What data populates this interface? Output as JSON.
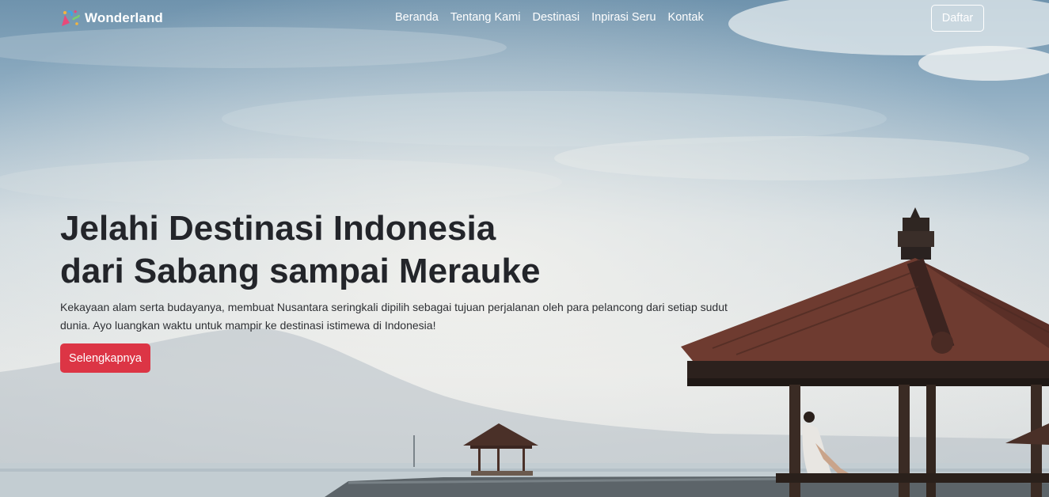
{
  "brand": {
    "name": "Wonderland",
    "logo_icon": "confetti-logo-icon"
  },
  "nav": {
    "items": [
      {
        "label": "Beranda"
      },
      {
        "label": "Tentang Kami"
      },
      {
        "label": "Destinasi"
      },
      {
        "label": "Inpirasi Seru"
      },
      {
        "label": "Kontak"
      }
    ],
    "signup_label": "Daftar"
  },
  "hero": {
    "title_line1": "Jelahi Destinasi Indonesia",
    "title_line2": "dari Sabang sampai Merauke",
    "description": "Kekayaan alam serta budayanya, membuat Nusantara seringkali dipilih sebagai tujuan perjalanan oleh para pelancong dari setiap sudut dunia. Ayo luangkan waktu untuk mampir ke destinasi istimewa di Indonesia!",
    "cta_label": "Selengkapnya"
  },
  "colors": {
    "accent": "#dc3545",
    "title_text": "#23252a",
    "nav_text": "#ffffff"
  }
}
